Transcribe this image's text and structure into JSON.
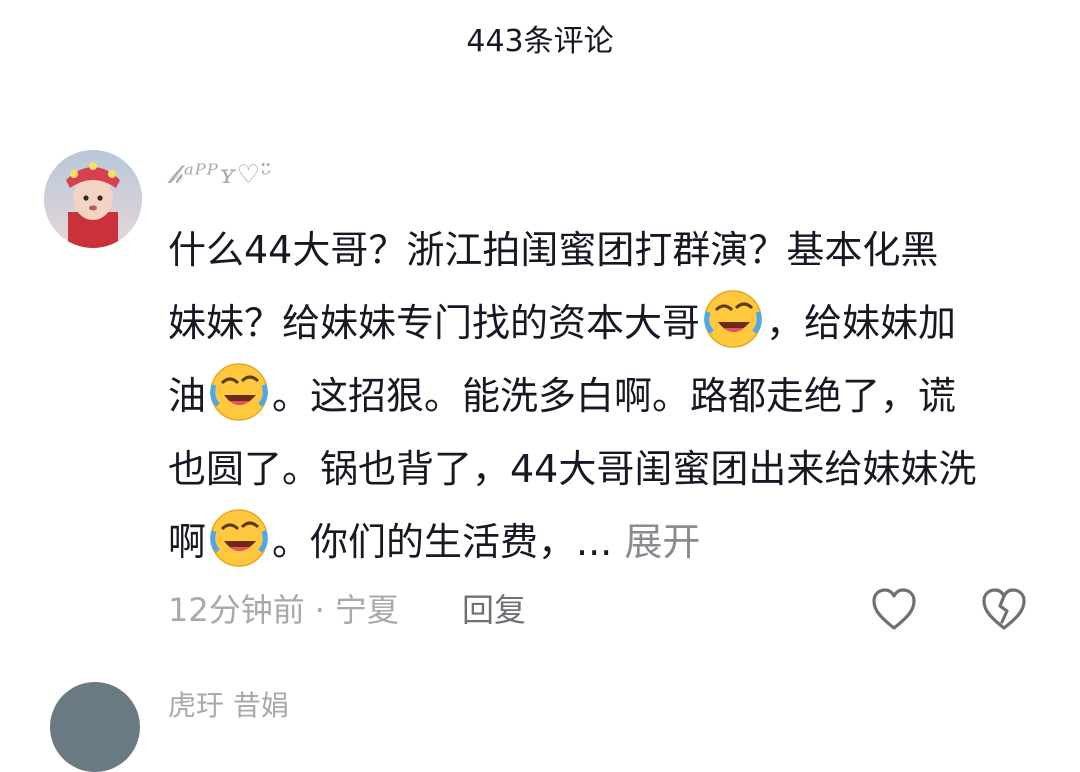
{
  "header": {
    "title": "443条评论"
  },
  "comment": {
    "username": "𝒽ᵃᴾᴾʏ♡ᵕ̈",
    "lines": [
      {
        "parts": [
          "什么44大哥？浙江拍闺蜜团打群演？基本化黑"
        ]
      },
      {
        "parts": [
          "妹妹？给妹妹专门找的资本大哥",
          "，给妹妹加"
        ]
      },
      {
        "parts": [
          "油",
          "。这招狠。能洗多白啊。路都走绝了，谎"
        ]
      },
      {
        "parts": [
          "也圆了。锅也背了，44大哥闺蜜团出来给妹妹洗"
        ]
      },
      {
        "parts": [
          "啊",
          "。你们的生活费，... "
        ]
      }
    ],
    "expand_label": "展开",
    "emoji_name": "laughing-crying-emoji",
    "time": "12分钟前",
    "separator": "·",
    "location": "宁夏",
    "reply_label": "回复",
    "like_icon": "heart-outline-icon",
    "dislike_icon": "broken-heart-icon"
  },
  "next_comment": {
    "username_partial": "虎玗 昔娟"
  }
}
